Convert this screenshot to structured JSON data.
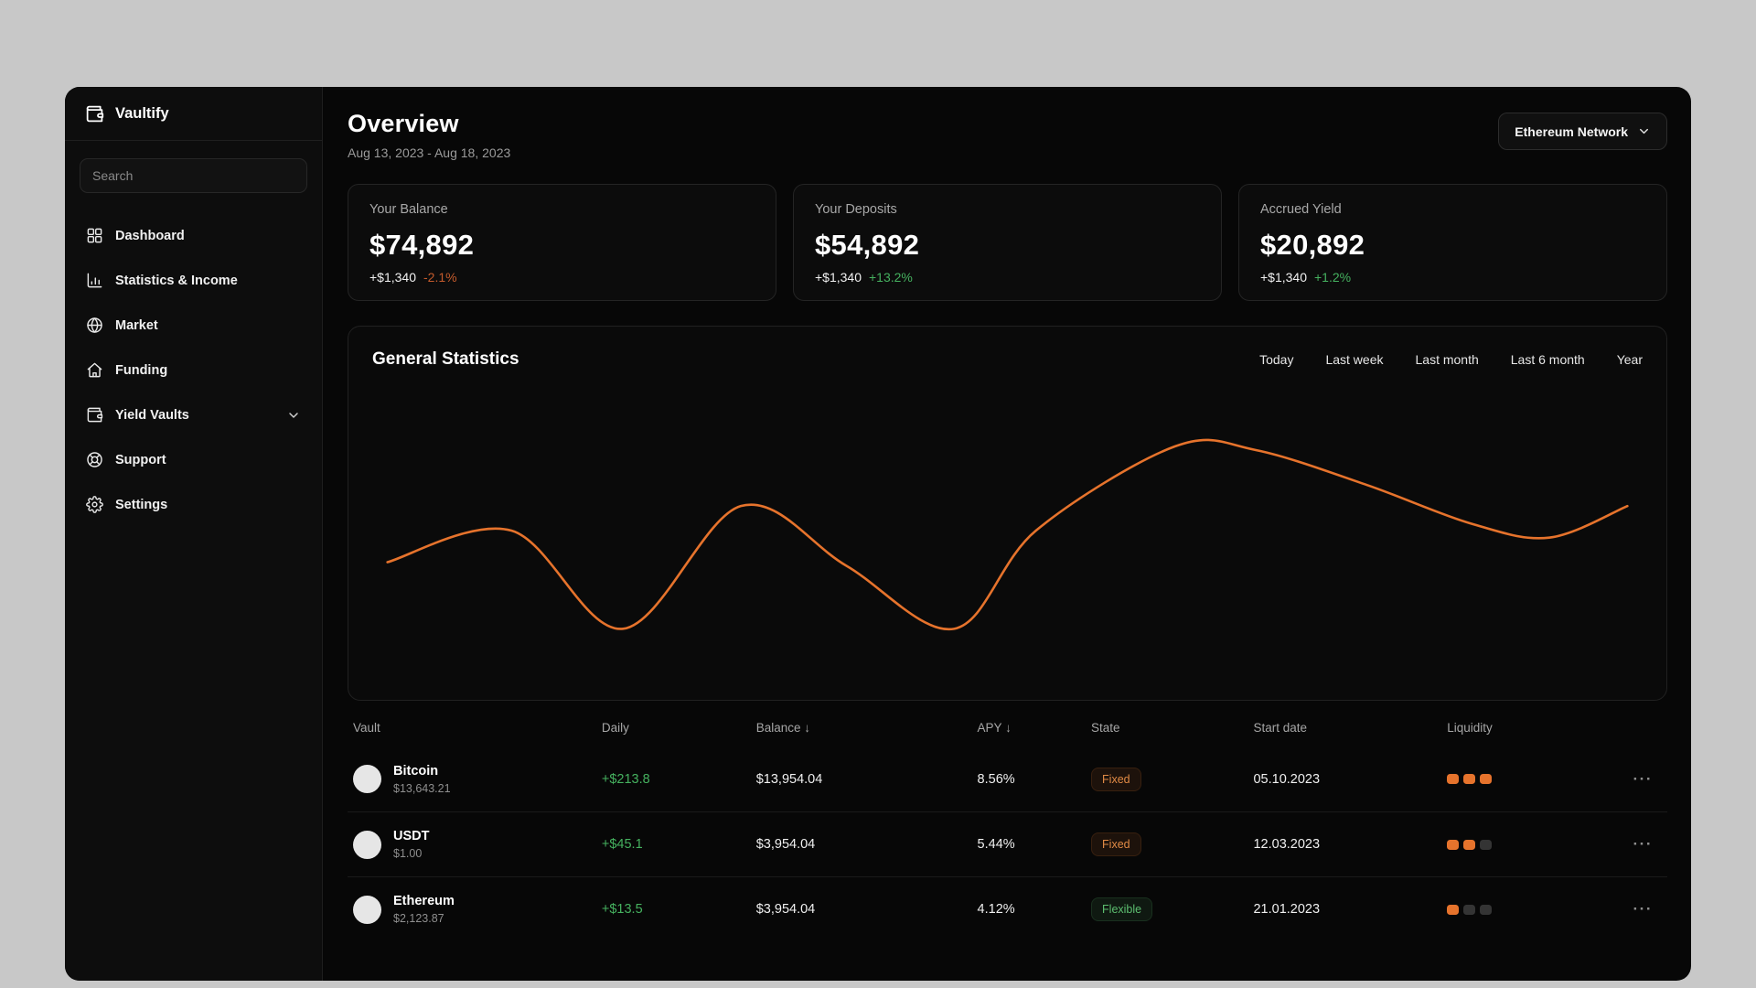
{
  "colors": {
    "accent": "#e6732c",
    "positive": "#45b15f",
    "negative": "#c45b2c"
  },
  "sidebar": {
    "brand": "Vaultify",
    "search_placeholder": "Search",
    "items": [
      {
        "label": "Dashboard",
        "icon": "grid"
      },
      {
        "label": "Statistics & Income",
        "icon": "chart"
      },
      {
        "label": "Market",
        "icon": "globe"
      },
      {
        "label": "Funding",
        "icon": "home"
      },
      {
        "label": "Yield Vaults",
        "icon": "wallet",
        "expandable": true
      },
      {
        "label": "Support",
        "icon": "lifebuoy"
      },
      {
        "label": "Settings",
        "icon": "gear"
      }
    ]
  },
  "header": {
    "title": "Overview",
    "date_range": "Aug 13, 2023 - Aug 18, 2023",
    "network_label": "Ethereum Network"
  },
  "stat_cards": [
    {
      "label": "Your Balance",
      "value": "$74,892",
      "change": "+$1,340",
      "percent": "-2.1%",
      "direction": "down"
    },
    {
      "label": "Your Deposits",
      "value": "$54,892",
      "change": "+$1,340",
      "percent": "+13.2%",
      "direction": "up"
    },
    {
      "label": "Accrued Yield",
      "value": "$20,892",
      "change": "+$1,340",
      "percent": "+1.2%",
      "direction": "up"
    }
  ],
  "statistics": {
    "title": "General Statistics",
    "filters": [
      "Today",
      "Last week",
      "Last month",
      "Last 6 month",
      "Year"
    ],
    "chart_data": {
      "type": "line",
      "series": [
        {
          "name": "General Statistics",
          "x": [
            0,
            10,
            19,
            28.5,
            37,
            45.7,
            52.3,
            63.5,
            70,
            79,
            87.4,
            93.7,
            100
          ],
          "values": [
            51,
            60,
            32,
            67,
            50,
            32,
            60,
            84,
            83,
            73,
            62,
            58,
            67
          ]
        }
      ],
      "line_color": "#e6732c",
      "grid": false,
      "axes_visible": false,
      "legend": "none"
    }
  },
  "table": {
    "sort_arrow": "↓",
    "row_menu": "···",
    "liquidity_max": 3,
    "columns": [
      {
        "label": "Vault"
      },
      {
        "label": "Daily"
      },
      {
        "label": "Balance",
        "sorted": true
      },
      {
        "label": "APY",
        "sorted": true
      },
      {
        "label": "State"
      },
      {
        "label": "Start date"
      },
      {
        "label": "Liquidity"
      },
      {
        "label": ""
      }
    ],
    "rows": [
      {
        "vault": "Bitcoin",
        "price": "$13,643.21",
        "daily": "+$213.8",
        "balance": "$13,954.04",
        "apy": "8.56%",
        "state": "Fixed",
        "state_type": "fixed",
        "start_date": "05.10.2023",
        "liquidity": 3
      },
      {
        "vault": "USDT",
        "price": "$1.00",
        "daily": "+$45.1",
        "balance": "$3,954.04",
        "apy": "5.44%",
        "state": "Fixed",
        "state_type": "fixed",
        "start_date": "12.03.2023",
        "liquidity": 2
      },
      {
        "vault": "Ethereum",
        "price": "$2,123.87",
        "daily": "+$13.5",
        "balance": "$3,954.04",
        "apy": "4.12%",
        "state": "Flexible",
        "state_type": "flexible",
        "start_date": "21.01.2023",
        "liquidity": 1
      }
    ]
  }
}
